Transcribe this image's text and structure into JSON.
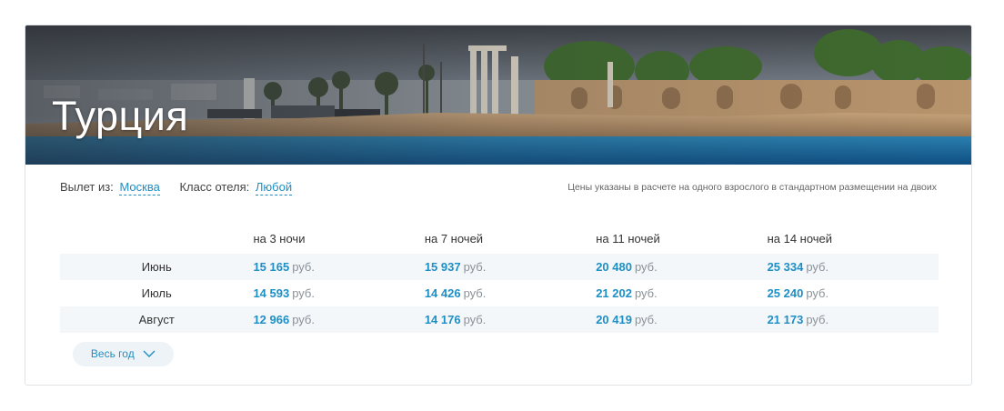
{
  "banner": {
    "title": "Турция"
  },
  "filters": {
    "departure_label": "Вылет из:",
    "departure_value": "Москва",
    "hotel_class_label": "Класс отеля:",
    "hotel_class_value": "Любой",
    "price_note": "Цены указаны в расчете на одного взрослого в стандартном размещении на двоих"
  },
  "table": {
    "columns": [
      "на 3 ночи",
      "на 7 ночей",
      "на 11 ночей",
      "на 14 ночей"
    ],
    "currency": "руб.",
    "rows": [
      {
        "month": "Июнь",
        "prices": [
          "15 165",
          "15 937",
          "20 480",
          "25 334"
        ]
      },
      {
        "month": "Июль",
        "prices": [
          "14 593",
          "14 426",
          "21 202",
          "25 240"
        ]
      },
      {
        "month": "Август",
        "prices": [
          "12 966",
          "14 176",
          "20 419",
          "21 173"
        ]
      }
    ]
  },
  "year_button": {
    "label": "Весь год",
    "icon": "chevron-down-icon"
  },
  "colors": {
    "accent": "#1e8fc5",
    "row_stripe": "#f4f7fa",
    "muted": "#8a9299"
  }
}
